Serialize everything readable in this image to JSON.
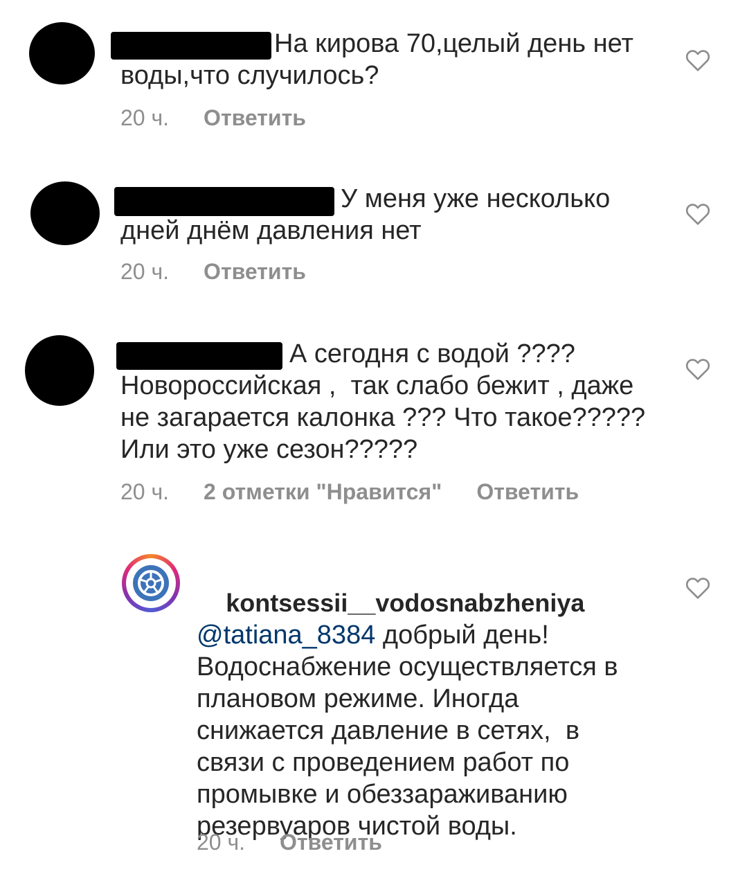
{
  "comments": [
    {
      "text": "На кирова 70,целый день нет воды,что случилось?",
      "time": "20 ч.",
      "reply_label": "Ответить"
    },
    {
      "text": "У меня уже несколько дней днём давления нет",
      "time": "20 ч.",
      "reply_label": "Ответить"
    },
    {
      "text": "А сегодня с водой ???? Новороссийская ,  так слабо бежит , даже не загарается калонка ??? Что такое????? Или это уже сезон?????",
      "time": "20 ч.",
      "likes_label": "2 отметки \"Нравится\"",
      "reply_label": "Ответить"
    }
  ],
  "reply": {
    "username": "kontsessii__vodosnabzheniya",
    "mention": "@tatiana_8384",
    "text": " добрый день! Водоснабжение осуществляется в плановом режиме. Иногда снижается давление в сетях,  в связи с проведением работ по промывке и обеззараживанию резервуаров чистой воды.",
    "time": "20 ч.",
    "reply_label": "Ответить"
  },
  "icons": {
    "like": "heart-outline-icon",
    "avatar_logo": "valve-wheel-logo-icon"
  },
  "colors": {
    "text": "#262626",
    "meta": "#8e8e8e",
    "mention": "#00376b",
    "logo": "#3d73b8"
  }
}
